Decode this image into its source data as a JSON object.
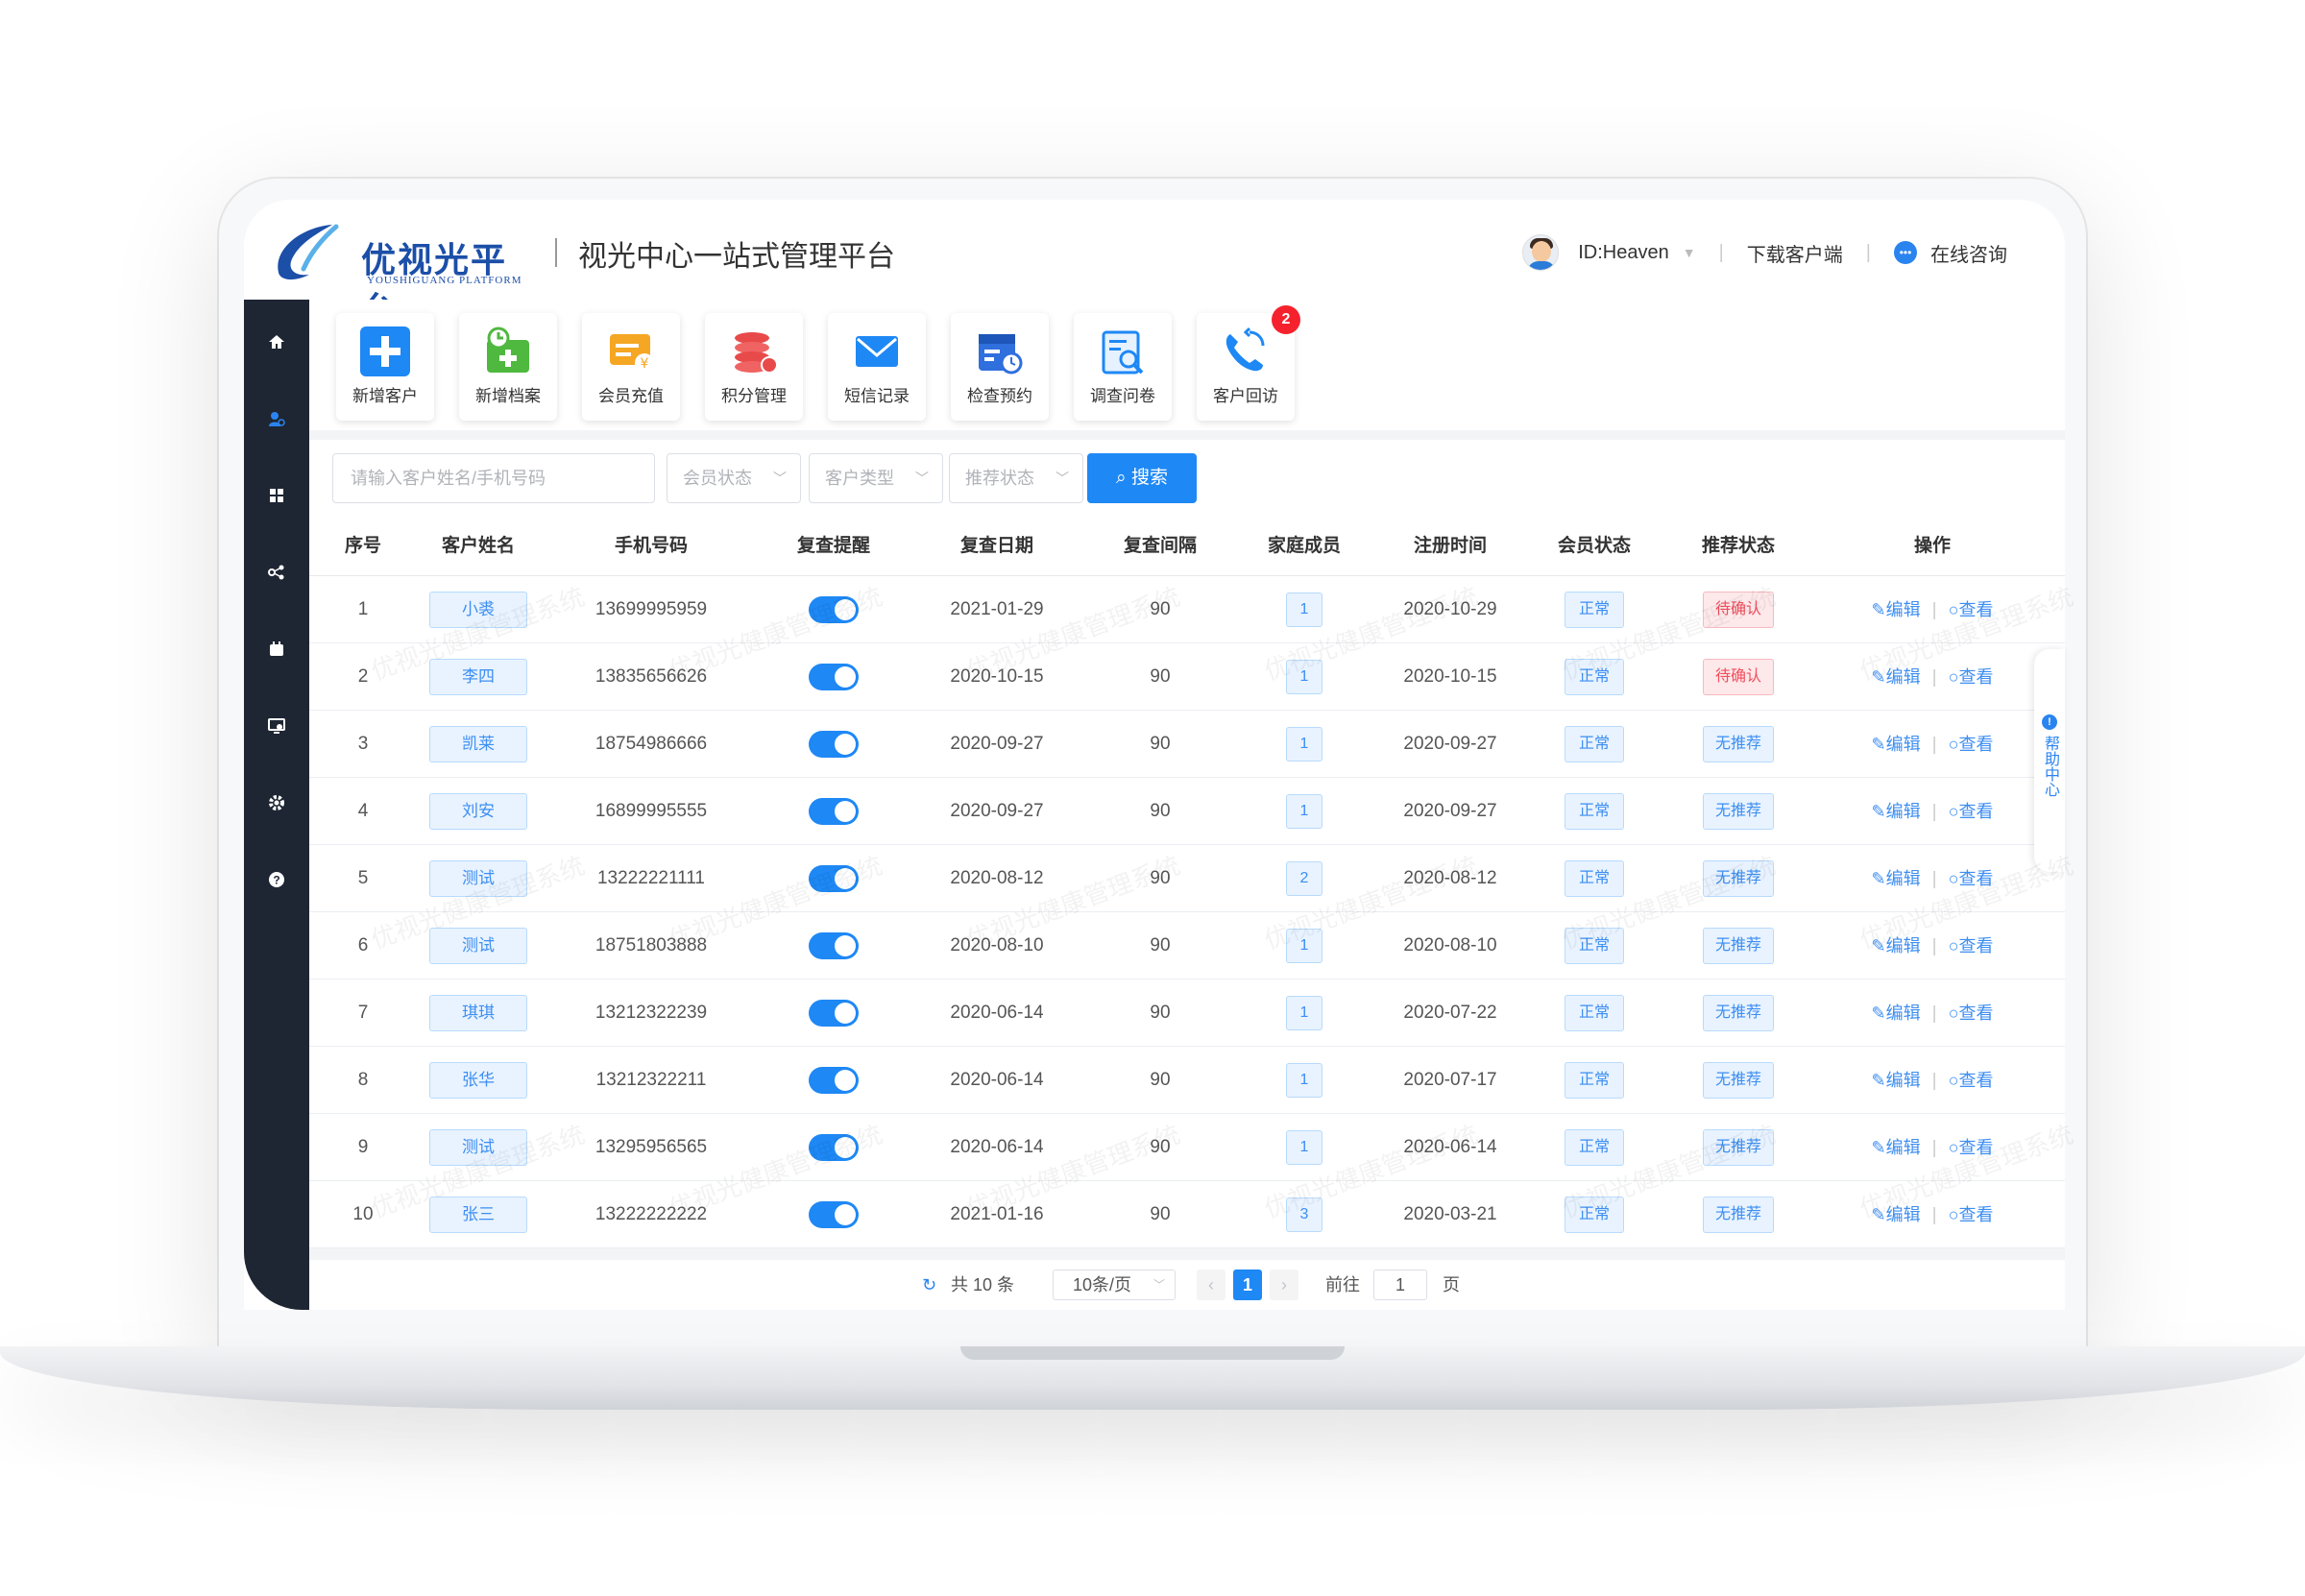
{
  "header": {
    "logo_title": "优视光平台",
    "logo_subtitle": "YOUSHIGUANG PLATFORM",
    "platform_title": "视光中心一站式管理平台",
    "user_id": "ID:Heaven",
    "download_client": "下载客户端",
    "online_consult": "在线咨询"
  },
  "sidebar": {
    "icons": [
      "home-icon",
      "customer-icon",
      "grid-icon",
      "share-icon",
      "calendar-icon",
      "monitor-icon",
      "settings-icon",
      "help-icon"
    ],
    "active_index": 1
  },
  "quick_actions": [
    {
      "label": "新增客户",
      "icon": "plus-icon",
      "color": "#1e88f5"
    },
    {
      "label": "新增档案",
      "icon": "archive-icon",
      "color": "#4fb83f"
    },
    {
      "label": "会员充值",
      "icon": "recharge-icon",
      "color": "#f5a623"
    },
    {
      "label": "积分管理",
      "icon": "points-icon",
      "color": "#e84a4a"
    },
    {
      "label": "短信记录",
      "icon": "mail-icon",
      "color": "#1e88f5"
    },
    {
      "label": "检查预约",
      "icon": "appointment-icon",
      "color": "#2f6fde"
    },
    {
      "label": "调查问卷",
      "icon": "survey-icon",
      "color": "#1e88f5"
    },
    {
      "label": "客户回访",
      "icon": "callback-icon",
      "color": "#1e88f5",
      "badge": "2"
    }
  ],
  "filters": {
    "search_placeholder": "请输入客户姓名/手机号码",
    "member_status": "会员状态",
    "customer_type": "客户类型",
    "recommend_status": "推荐状态",
    "search_button": "搜索"
  },
  "table": {
    "headers": [
      "序号",
      "客户姓名",
      "手机号码",
      "复查提醒",
      "复查日期",
      "复查间隔",
      "家庭成员",
      "注册时间",
      "会员状态",
      "推荐状态",
      "操作"
    ],
    "edit_label": "编辑",
    "view_label": "查看",
    "rows": [
      {
        "no": "1",
        "name": "小裘",
        "phone": "13699995959",
        "date": "2021-01-29",
        "interval": "90",
        "family": "1",
        "reg": "2020-10-29",
        "member": "正常",
        "recommend": "待确认",
        "rec_type": "red"
      },
      {
        "no": "2",
        "name": "李四",
        "phone": "13835656626",
        "date": "2020-10-15",
        "interval": "90",
        "family": "1",
        "reg": "2020-10-15",
        "member": "正常",
        "recommend": "待确认",
        "rec_type": "red"
      },
      {
        "no": "3",
        "name": "凯莱",
        "phone": "18754986666",
        "date": "2020-09-27",
        "interval": "90",
        "family": "1",
        "reg": "2020-09-27",
        "member": "正常",
        "recommend": "无推荐",
        "rec_type": "blue"
      },
      {
        "no": "4",
        "name": "刘安",
        "phone": "16899995555",
        "date": "2020-09-27",
        "interval": "90",
        "family": "1",
        "reg": "2020-09-27",
        "member": "正常",
        "recommend": "无推荐",
        "rec_type": "blue"
      },
      {
        "no": "5",
        "name": "测试",
        "phone": "13222221111",
        "date": "2020-08-12",
        "interval": "90",
        "family": "2",
        "reg": "2020-08-12",
        "member": "正常",
        "recommend": "无推荐",
        "rec_type": "blue"
      },
      {
        "no": "6",
        "name": "测试",
        "phone": "18751803888",
        "date": "2020-08-10",
        "interval": "90",
        "family": "1",
        "reg": "2020-08-10",
        "member": "正常",
        "recommend": "无推荐",
        "rec_type": "blue"
      },
      {
        "no": "7",
        "name": "琪琪",
        "phone": "13212322239",
        "date": "2020-06-14",
        "interval": "90",
        "family": "1",
        "reg": "2020-07-22",
        "member": "正常",
        "recommend": "无推荐",
        "rec_type": "blue"
      },
      {
        "no": "8",
        "name": "张华",
        "phone": "13212322211",
        "date": "2020-06-14",
        "interval": "90",
        "family": "1",
        "reg": "2020-07-17",
        "member": "正常",
        "recommend": "无推荐",
        "rec_type": "blue"
      },
      {
        "no": "9",
        "name": "测试",
        "phone": "13295956565",
        "date": "2020-06-14",
        "interval": "90",
        "family": "1",
        "reg": "2020-06-14",
        "member": "正常",
        "recommend": "无推荐",
        "rec_type": "blue"
      },
      {
        "no": "10",
        "name": "张三",
        "phone": "13222222222",
        "date": "2021-01-16",
        "interval": "90",
        "family": "3",
        "reg": "2020-03-21",
        "member": "正常",
        "recommend": "无推荐",
        "rec_type": "blue"
      }
    ]
  },
  "pagination": {
    "total": "共 10 条",
    "page_size": "10条/页",
    "current_page": "1",
    "goto_label": "前往",
    "goto_value": "1",
    "page_unit": "页"
  },
  "help_tab": {
    "label": "帮助中心"
  },
  "watermark": "优视光健康管理系统"
}
